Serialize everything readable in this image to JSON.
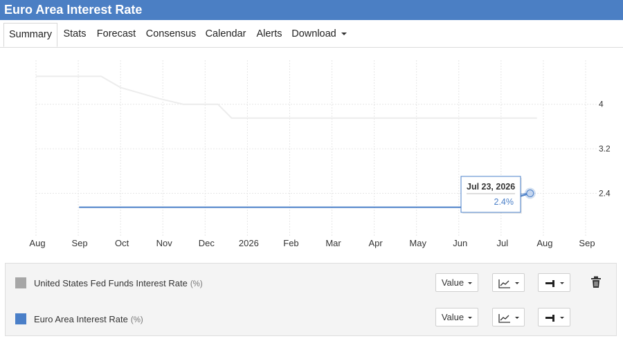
{
  "window": {
    "title": "Euro Area Interest Rate"
  },
  "tabs": [
    {
      "label": "Summary",
      "active": true
    },
    {
      "label": "Stats"
    },
    {
      "label": "Forecast"
    },
    {
      "label": "Consensus"
    },
    {
      "label": "Calendar"
    },
    {
      "label": "Alerts"
    },
    {
      "label": "Download",
      "dropdown": true
    }
  ],
  "chart_data": {
    "type": "line",
    "x_labels": [
      "Aug",
      "Sep",
      "Oct",
      "Nov",
      "Dec",
      "2026",
      "Feb",
      "Mar",
      "Apr",
      "May",
      "Jun",
      "Jul",
      "Aug",
      "Sep"
    ],
    "y_ticks": [
      2.4,
      3.2,
      4
    ],
    "y_axis_position": "right",
    "grid": true,
    "series": [
      {
        "name": "United States Fed Funds Interest Rate",
        "unit": "%",
        "color": "#ececec",
        "points": [
          {
            "x": "2025-08-01",
            "y": 4.5
          },
          {
            "x": "2025-09-17",
            "y": 4.5
          },
          {
            "x": "2025-10-01",
            "y": 4.3
          },
          {
            "x": "2025-10-29",
            "y": 4.1
          },
          {
            "x": "2025-11-15",
            "y": 4.0
          },
          {
            "x": "2025-12-10",
            "y": 4.0
          },
          {
            "x": "2025-12-20",
            "y": 3.75
          },
          {
            "x": "2026-07-28",
            "y": 3.75
          }
        ]
      },
      {
        "name": "Euro Area Interest Rate",
        "unit": "%",
        "color": "#4a7fc8",
        "points": [
          {
            "x": "2025-09-01",
            "y": 2.15
          },
          {
            "x": "2026-06-20",
            "y": 2.15
          },
          {
            "x": "2026-07-23",
            "y": 2.4
          }
        ]
      }
    ],
    "tooltip": {
      "date": "Jul 23, 2026",
      "value": "2.4%"
    }
  },
  "legend": {
    "rows": [
      {
        "name": "United States Fed Funds Interest Rate",
        "unit": "(%)",
        "swatch_color": "#a6a6a6",
        "value_label": "Value",
        "chart_type_icon": "line-chart-icon",
        "marker_icon": "bar-marker-icon",
        "removable": true
      },
      {
        "name": "Euro Area Interest Rate",
        "unit": "(%)",
        "swatch_color": "#4a7fc8",
        "value_label": "Value",
        "chart_type_icon": "line-chart-icon",
        "marker_icon": "bar-marker-icon",
        "removable": false
      }
    ]
  }
}
